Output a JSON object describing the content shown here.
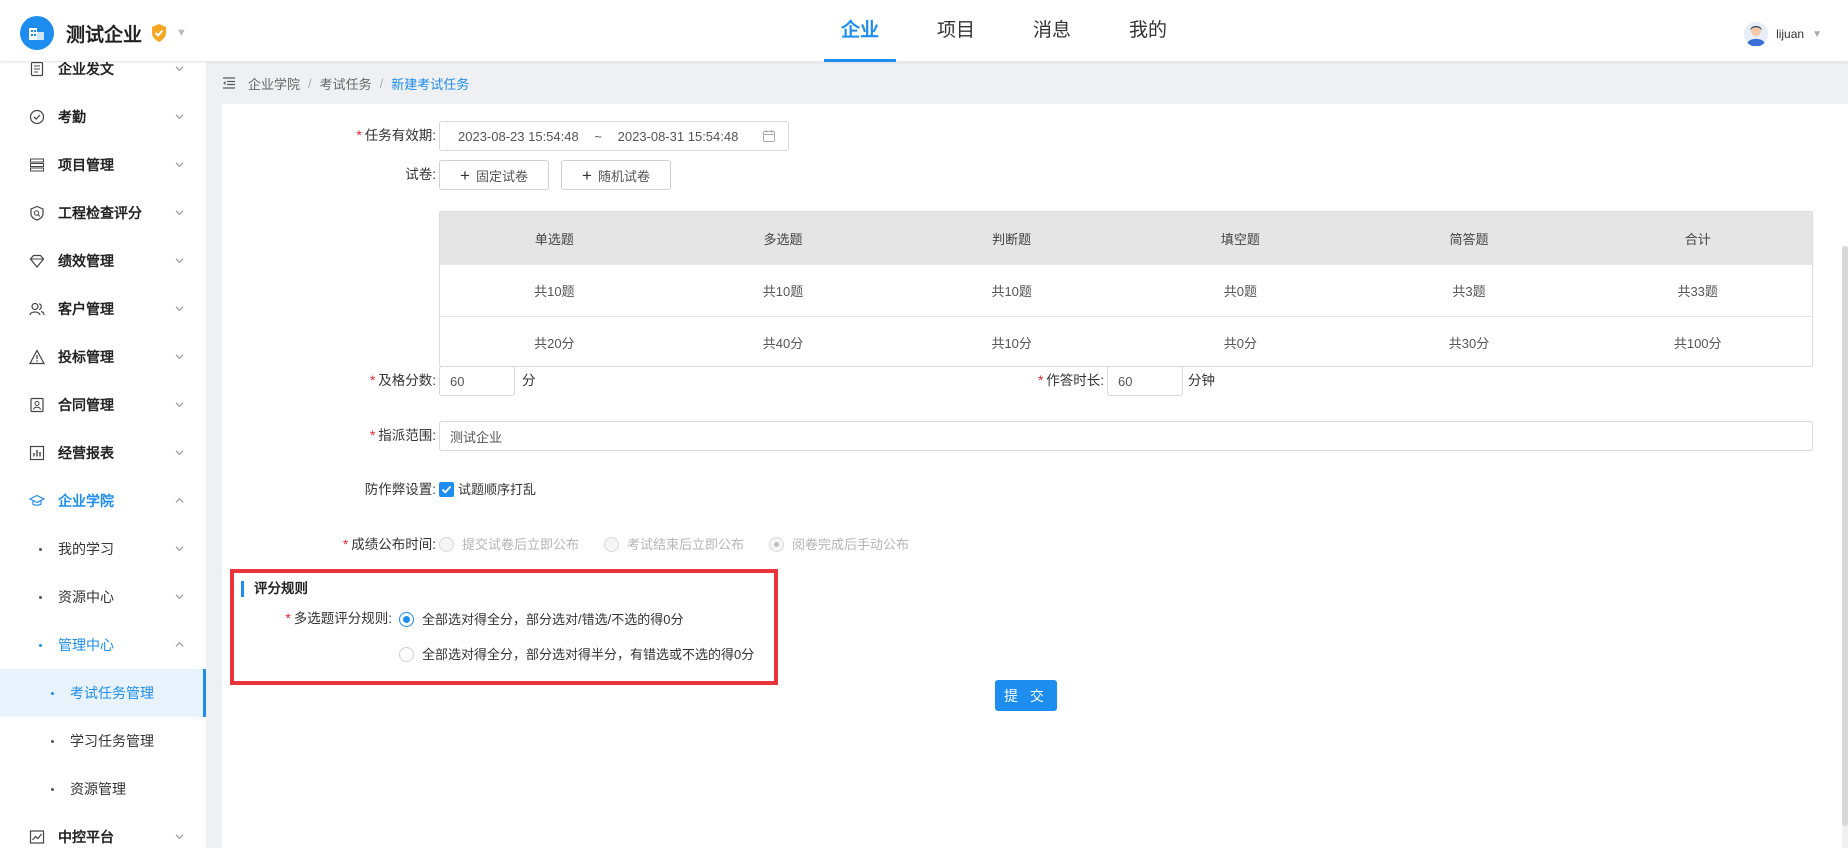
{
  "app": {
    "company_name": "测试企业",
    "verified_icon": "shield-check-icon",
    "logo_icon": "building-icon"
  },
  "main_nav": [
    {
      "label": "企业",
      "active": true
    },
    {
      "label": "项目",
      "active": false
    },
    {
      "label": "消息",
      "active": false
    },
    {
      "label": "我的",
      "active": false
    }
  ],
  "user": {
    "name": "lijuan",
    "avatar_icon": "user-avatar-icon"
  },
  "sidebar": {
    "items": [
      {
        "label": "企业发文",
        "icon": "document-icon"
      },
      {
        "label": "考勤",
        "icon": "check-circle-icon"
      },
      {
        "label": "项目管理",
        "icon": "list-icon"
      },
      {
        "label": "工程检查评分",
        "icon": "inspect-icon"
      },
      {
        "label": "绩效管理",
        "icon": "diamond-icon"
      },
      {
        "label": "客户管理",
        "icon": "users-icon"
      },
      {
        "label": "投标管理",
        "icon": "warning-icon"
      },
      {
        "label": "合同管理",
        "icon": "contract-icon"
      },
      {
        "label": "经营报表",
        "icon": "bar-chart-icon"
      },
      {
        "label": "企业学院",
        "icon": "graduation-cap-icon",
        "open": true
      },
      {
        "label": "我的学习",
        "level": 2
      },
      {
        "label": "资源中心",
        "level": 2
      },
      {
        "label": "管理中心",
        "level": 2,
        "open": true
      },
      {
        "label": "考试任务管理",
        "level": 3,
        "active": true
      },
      {
        "label": "学习任务管理",
        "level": 3
      },
      {
        "label": "资源管理",
        "level": 3
      },
      {
        "label": "中控平台",
        "icon": "dashboard-icon"
      }
    ]
  },
  "breadcrumb": [
    "企业学院",
    "考试任务",
    "新建考试任务"
  ],
  "form": {
    "validity": {
      "label": "任务有效期:",
      "start": "2023-08-23 15:54:48",
      "separator": "~",
      "end": "2023-08-31 15:54:48"
    },
    "paper": {
      "label": "试卷:",
      "fixed_button": "固定试卷",
      "random_button": "随机试卷"
    },
    "summary_table": {
      "headers": [
        "单选题",
        "多选题",
        "判断题",
        "填空题",
        "简答题",
        "合计"
      ],
      "rows": [
        [
          "共10题",
          "共10题",
          "共10题",
          "共0题",
          "共3题",
          "共33题"
        ],
        [
          "共20分",
          "共40分",
          "共10分",
          "共0分",
          "共30分",
          "共100分"
        ]
      ]
    },
    "pass_score": {
      "label": "及格分数:",
      "value": "60",
      "unit": "分"
    },
    "duration": {
      "label": "作答时长:",
      "value": "60",
      "unit": "分钟"
    },
    "scope": {
      "label": "指派范围:",
      "value": "测试企业"
    },
    "anti_cheat": {
      "label": "防作弊设置:",
      "option": "试题顺序打乱",
      "checked": true
    },
    "publish_time": {
      "label": "成绩公布时间:",
      "options": [
        {
          "label": "提交试卷后立即公布",
          "checked": false
        },
        {
          "label": "考试结束后立即公布",
          "checked": false
        },
        {
          "label": "阅卷完成后手动公布",
          "checked": true
        }
      ]
    },
    "scoring_rules": {
      "title": "评分规则",
      "multi_choice_label": "多选题评分规则:",
      "options": [
        {
          "label": "全部选对得全分，部分选对/错选/不选的得0分",
          "checked": true
        },
        {
          "label": "全部选对得全分，部分选对得半分，有错选或不选的得0分",
          "checked": false
        }
      ]
    },
    "submit_button": "提 交"
  },
  "colors": {
    "accent": "#1d8df0",
    "highlight": "#e9343a",
    "required": "#f5222d"
  }
}
